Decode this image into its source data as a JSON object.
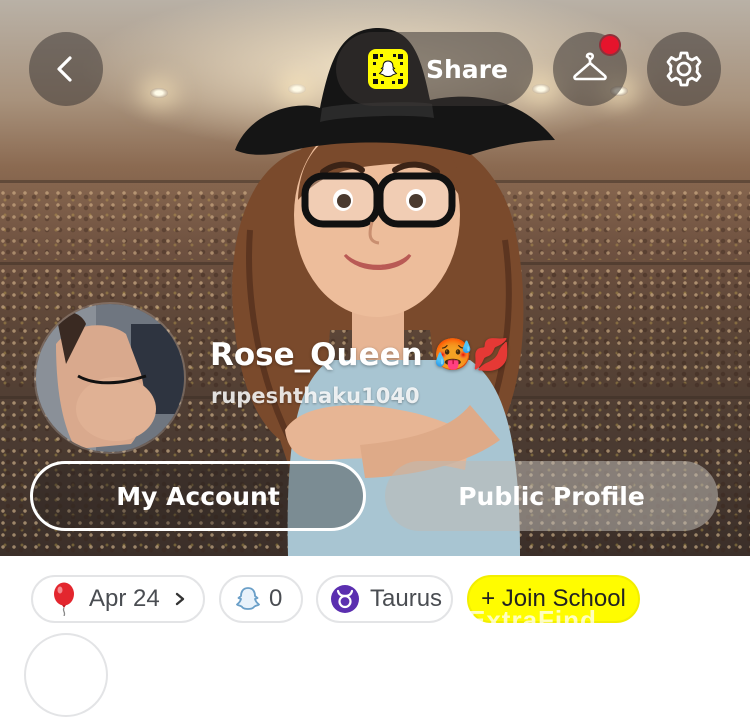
{
  "header": {
    "share_label": "Share",
    "notification_badge_color": "#e6142c"
  },
  "profile": {
    "display_name": "Rose_Queen 🥵💋",
    "username": "rupeshthaku1040"
  },
  "actions": {
    "my_account_label": "My Account",
    "public_profile_label": "Public Profile"
  },
  "chips": {
    "birthday": "Apr 24",
    "friends_count": "0",
    "zodiac": "Taurus",
    "join_school": "+ Join School"
  },
  "icons": {
    "back": "chevron-left-icon",
    "snapcode": "snapcode-icon",
    "closet": "hanger-icon",
    "settings": "gear-icon",
    "birthday": "balloon-icon",
    "friends": "ghost-icon",
    "zodiac": "taurus-icon"
  },
  "colors": {
    "snap_yellow": "#fffc00",
    "zodiac_purple": "#5b2fb0"
  },
  "watermark": "ExtraFind"
}
